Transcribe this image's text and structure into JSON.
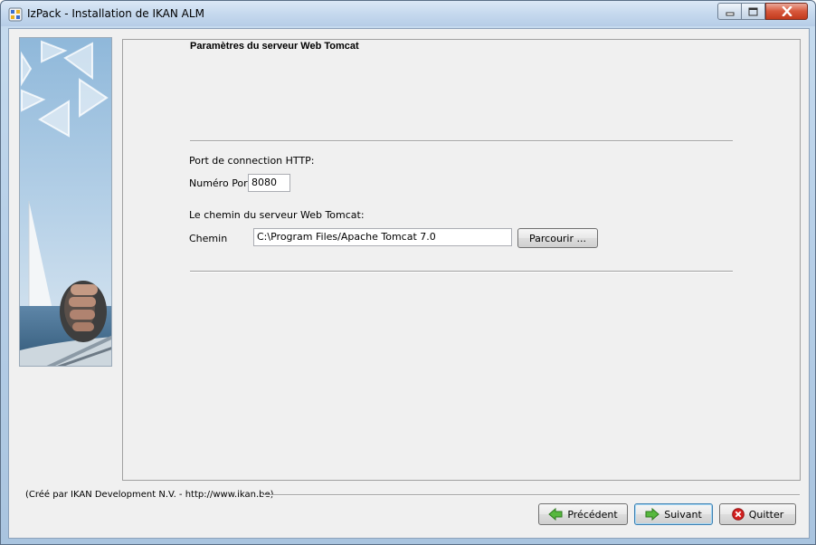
{
  "window": {
    "title": "IzPack - Installation de IKAN ALM",
    "controls": {
      "minimize_icon": "minimize-icon",
      "maximize_icon": "maximize-icon",
      "close_icon": "close-icon"
    }
  },
  "panel": {
    "title": "Paramètres du serveur Web Tomcat",
    "http_section_label": "Port de connection HTTP:",
    "port_label": "Numéro Port",
    "port_value": "8080",
    "path_section_label": "Le chemin du serveur Web Tomcat:",
    "path_label": "Chemin",
    "path_value": "C:\\Program Files/Apache Tomcat 7.0",
    "browse_label": "Parcourir ..."
  },
  "footer": {
    "credits": "(Créé par IKAN Development N.V. - http://www.ikan.be)",
    "prev_label": "Précédent",
    "next_label": "Suivant",
    "quit_label": "Quitter"
  },
  "colors": {
    "accent_green": "#3a9a2a",
    "quit_red": "#d42020",
    "title_bar": "#c6d9ee"
  }
}
